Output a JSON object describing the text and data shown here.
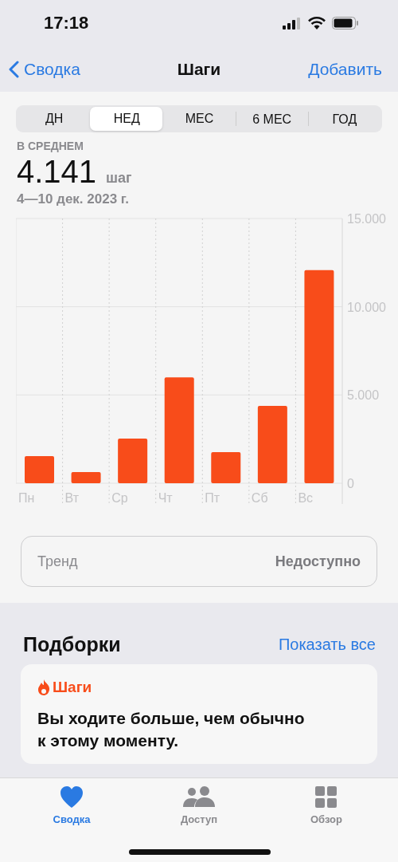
{
  "status_bar": {
    "time": "17:18"
  },
  "nav": {
    "back": "Сводка",
    "title": "Шаги",
    "action": "Добавить"
  },
  "segments": [
    {
      "label": "ДН",
      "selected": false
    },
    {
      "label": "НЕД",
      "selected": true
    },
    {
      "label": "МЕС",
      "selected": false
    },
    {
      "label": "6 МЕС",
      "selected": false
    },
    {
      "label": "ГОД",
      "selected": false
    }
  ],
  "summary": {
    "label": "В СРЕДНЕМ",
    "value": "4.141",
    "unit": "шаг",
    "date_range": "4—10 дек. 2023 г."
  },
  "chart_data": {
    "type": "bar",
    "categories": [
      "Пн",
      "Вт",
      "Ср",
      "Чт",
      "Пт",
      "Сб",
      "Вс"
    ],
    "series": [
      {
        "color": "#f84c1a",
        "values": [
          1540,
          630,
          2530,
          6000,
          1760,
          4380,
          12080
        ]
      }
    ],
    "ylim": [
      0,
      15000
    ],
    "yticks": [
      {
        "value": 0,
        "label": "0"
      },
      {
        "value": 5000,
        "label": "5.000"
      },
      {
        "value": 10000,
        "label": "10.000"
      },
      {
        "value": 15000,
        "label": "15.000"
      }
    ]
  },
  "trend": {
    "label": "Тренд",
    "value": "Недоступно"
  },
  "highlights": {
    "title": "Подборки",
    "show_all": "Показать все",
    "card": {
      "category": "Шаги",
      "text": "Вы ходите больше, чем обычно к этому моменту."
    }
  },
  "tab_bar": [
    {
      "label": "Сводка",
      "kind": "heart",
      "selected": true
    },
    {
      "label": "Доступ",
      "kind": "people",
      "selected": false
    },
    {
      "label": "Обзор",
      "kind": "grid",
      "selected": false
    }
  ]
}
